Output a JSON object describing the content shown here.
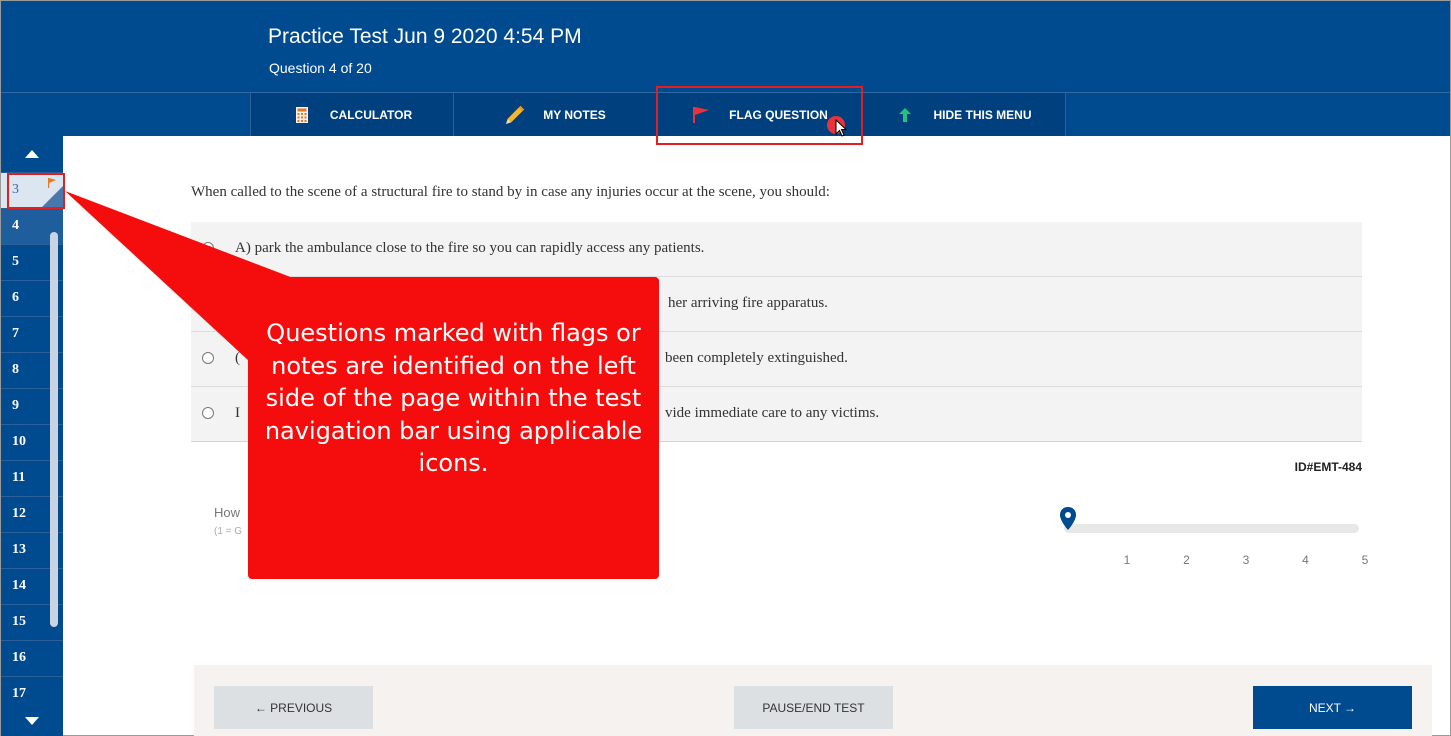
{
  "header": {
    "title": "Practice Test Jun 9 2020 4:54 PM",
    "question_counter": "Question 4 of 20"
  },
  "toolbar": {
    "calculator": "CALCULATOR",
    "notes": "MY NOTES",
    "flag": "FLAG QUESTION",
    "hide_menu": "HIDE THIS MENU"
  },
  "nav": {
    "items": [
      "3",
      "4",
      "5",
      "6",
      "7",
      "8",
      "9",
      "10",
      "11",
      "12",
      "13",
      "14",
      "15",
      "16",
      "17"
    ],
    "current": "4",
    "flagged": "3"
  },
  "question": {
    "text": "When called to the scene of a structural fire to stand by in case any injuries occur at the scene, you should:",
    "answers": [
      "A) park the ambulance close to the fire so you can rapidly access any patients.",
      "her arriving fire apparatus.",
      "been completely extinguished.",
      "vide immediate care to any victims."
    ],
    "answer_prefixes": [
      "",
      "",
      "(",
      "I"
    ],
    "item_id": "ID#EMT-484"
  },
  "rating": {
    "label": "How",
    "hint": "(1 = G",
    "scale": [
      "1",
      "2",
      "3",
      "4",
      "5"
    ],
    "value": 0
  },
  "footer": {
    "previous": "← PREVIOUS",
    "pause": "PAUSE/END TEST",
    "next": "NEXT →"
  },
  "callout": {
    "text": "Questions marked with flags or notes are identified on the left side of the page within the test navigation bar using applicable icons."
  },
  "colors": {
    "brand_blue": "#004a8f",
    "callout_red": "#f50d0d",
    "highlight_red": "#e02020",
    "flag_red": "#e8333c",
    "arrow_green": "#27c27a"
  }
}
